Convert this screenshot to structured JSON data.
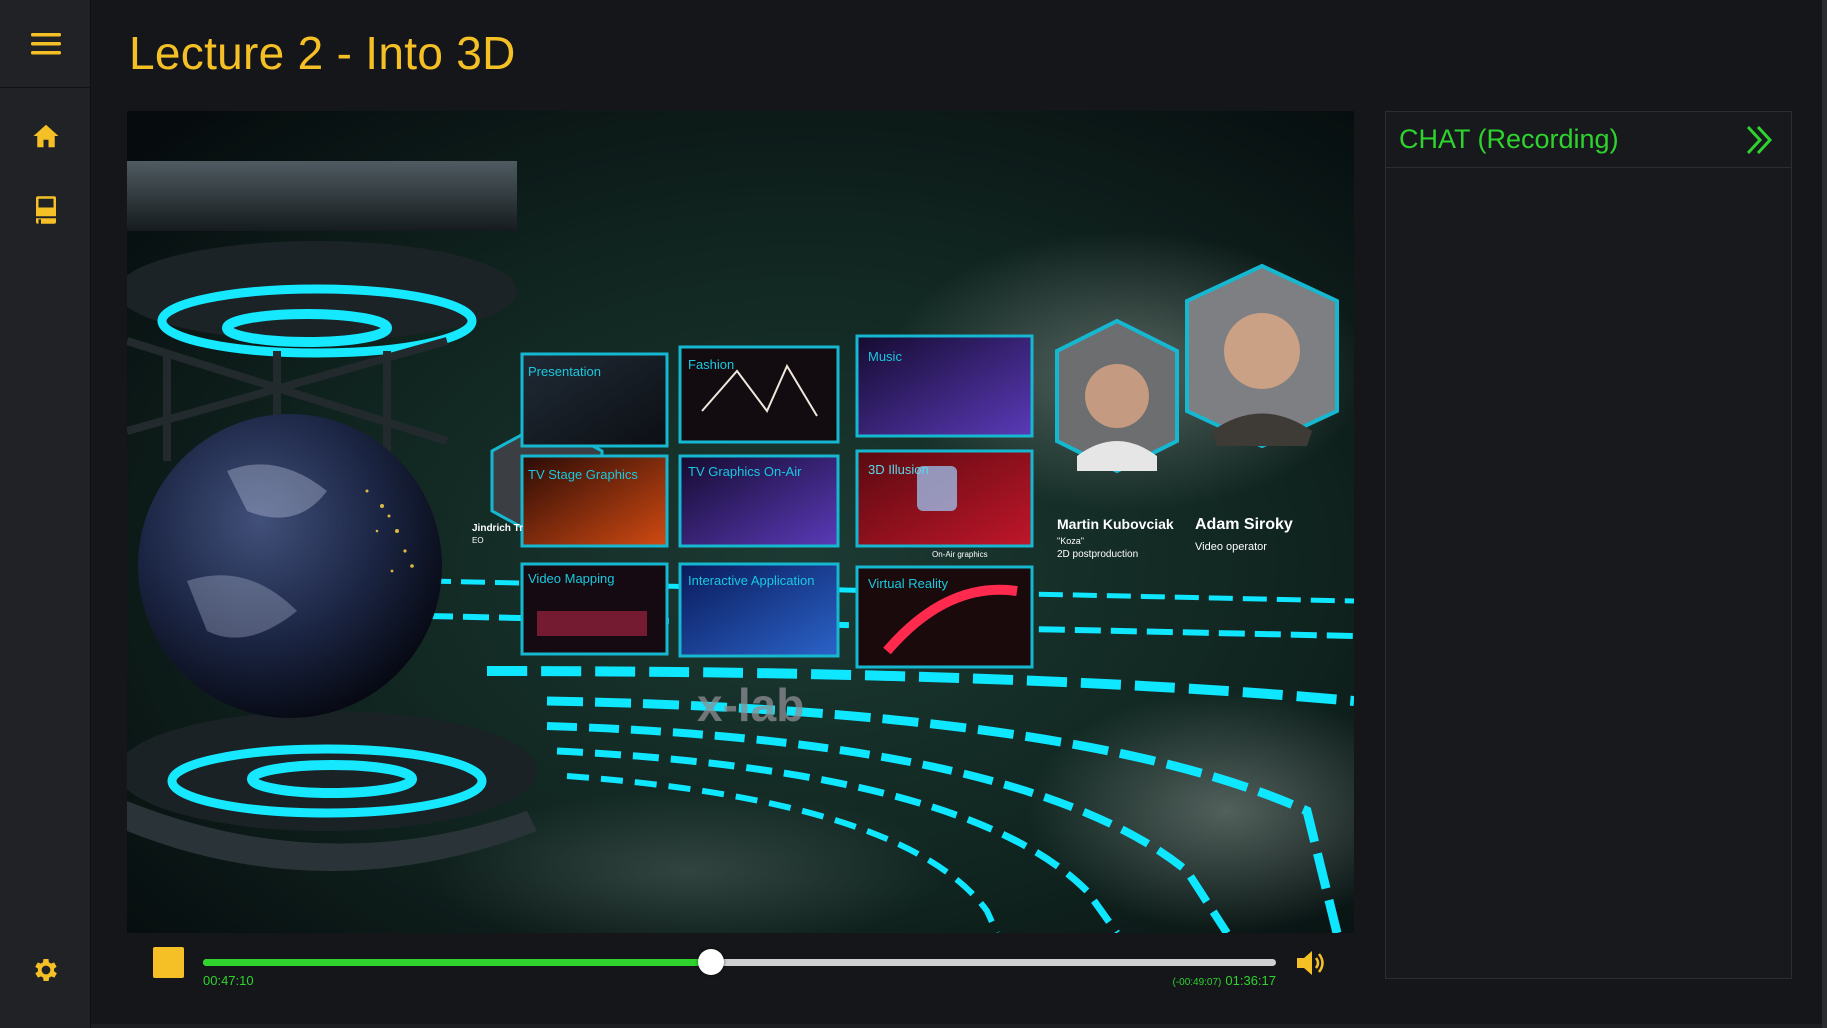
{
  "page": {
    "title": "Lecture 2 - Into 3D"
  },
  "sidebar": {
    "menu_icon": "hamburger-menu-icon",
    "items": [
      {
        "name": "home",
        "icon": "home-icon"
      },
      {
        "name": "library",
        "icon": "book-icon"
      }
    ],
    "settings_icon": "gear-icon"
  },
  "video": {
    "tiles": [
      {
        "label": "Presentation"
      },
      {
        "label": "Fashion"
      },
      {
        "label": "Music"
      },
      {
        "label": "TV Stage Graphics"
      },
      {
        "label": "TV Graphics On-Air"
      },
      {
        "label": "3D Illusion"
      },
      {
        "label": "Video Mapping"
      },
      {
        "label": "Interactive Application"
      },
      {
        "label": "Virtual Reality"
      }
    ],
    "people": [
      {
        "name": "Martin Kubovciak",
        "role_line1": "\"Koza\"",
        "role_line2": "2D postproduction"
      },
      {
        "name": "Adam Siroky",
        "role_line1": "Video operator",
        "role_line2": ""
      }
    ],
    "partial_labels": {
      "left_name": "Jindrich Tr",
      "left_role": "EO",
      "small_center": "On-Air graphics"
    },
    "logo_text": "x-lab"
  },
  "player": {
    "current_time": "00:47:10",
    "remaining_time": "(-00:49:07)",
    "total_time": "01:36:17",
    "progress": 0.473,
    "accent_color": "#2ed32e",
    "control_color": "#f5c026",
    "stop_icon": "stop-icon",
    "volume_icon": "speaker-volume-icon"
  },
  "chat": {
    "title": "CHAT (Recording)",
    "collapse_icon": "double-chevron-right-icon"
  }
}
